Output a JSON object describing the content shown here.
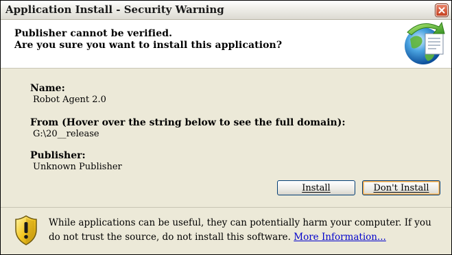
{
  "window": {
    "title": "Application Install - Security Warning"
  },
  "header": {
    "line1": "Publisher cannot be verified.",
    "line2": "Are you sure you want to install this application?"
  },
  "fields": {
    "name_label": "Name:",
    "name_value": "Robot Agent 2.0",
    "from_label": "From (Hover over the string below to see the full domain):",
    "from_value": "G:\\20__release",
    "publisher_label": "Publisher:",
    "publisher_value": "Unknown Publisher"
  },
  "buttons": {
    "install": "Install",
    "dont_install": "Don't Install"
  },
  "footer": {
    "message": "While applications can be useful, they can potentially harm your computer. If you do not trust the source, do not install this software. ",
    "link": "More Information..."
  },
  "icons": {
    "close": "close-icon",
    "globe": "globe-install-icon",
    "warning": "warning-shield-icon"
  },
  "colors": {
    "close_button": "#c44220",
    "link": "#0000cc",
    "body_background": "#ece9d8",
    "default_button_highlight": "#e8a24a"
  }
}
